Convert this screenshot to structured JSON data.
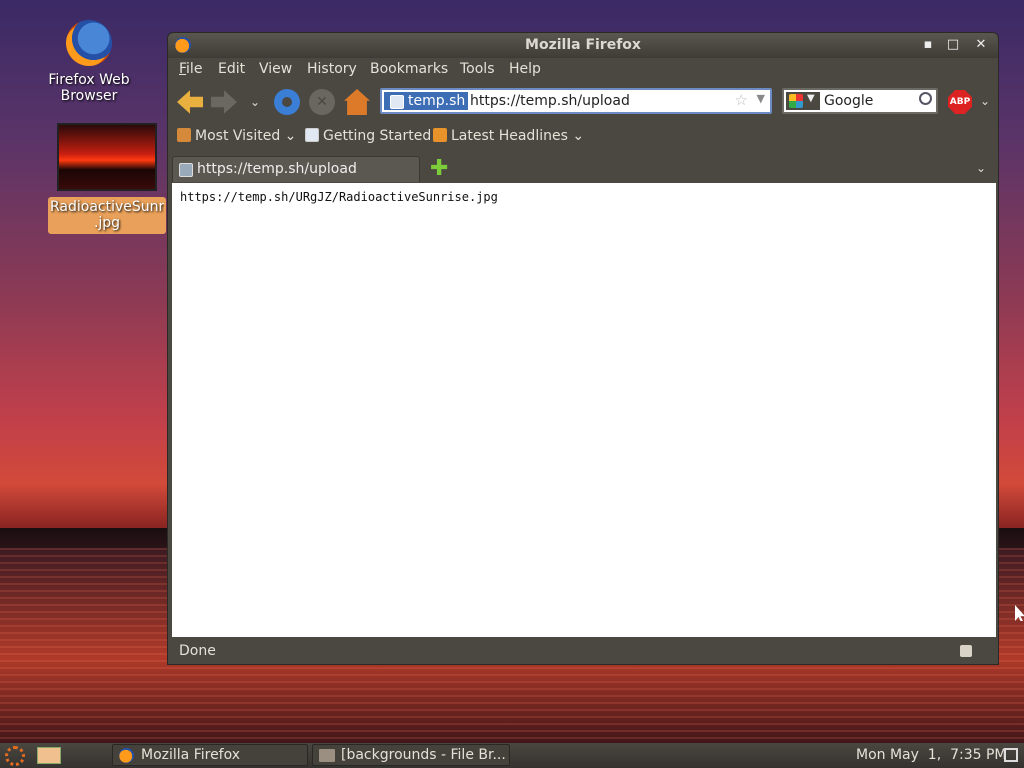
{
  "desktop": {
    "icons": [
      {
        "label": "Firefox Web Browser",
        "icon": "firefox-icon"
      },
      {
        "label_line1": "RadioactiveSunris",
        "label_line2": ".jpg",
        "icon": "image-thumbnail"
      }
    ]
  },
  "window": {
    "title": "Mozilla Firefox",
    "controls": {
      "minimize": "▪",
      "maximize": "□",
      "close": "✕"
    },
    "menu": [
      "File",
      "Edit",
      "View",
      "History",
      "Bookmarks",
      "Tools",
      "Help"
    ],
    "menu_mnemonics": [
      "F",
      "E",
      "V",
      "i",
      "B",
      "T",
      "H"
    ],
    "nav": {
      "site_badge": "temp.sh",
      "url": "https://temp.sh/upload",
      "search_engine": "Google",
      "adblock_label": "ABP"
    },
    "bookmarks": [
      {
        "label": "Most Visited",
        "dropdown": true
      },
      {
        "label": "Getting Started",
        "dropdown": false
      },
      {
        "label": "Latest Headlines",
        "dropdown": true
      }
    ],
    "tabs": [
      {
        "label": "https://temp.sh/upload",
        "active": true
      }
    ],
    "content_text": "https://temp.sh/URgJZ/RadioactiveSunrise.jpg",
    "status": "Done"
  },
  "panel": {
    "tasks": [
      {
        "label": "Mozilla Firefox",
        "icon": "firefox-icon"
      },
      {
        "label": "[backgrounds - File Br...",
        "icon": "file-browser-icon"
      }
    ],
    "clock": "Mon May  1,  7:35 PM"
  },
  "colors": {
    "window_bg": "#4b4842",
    "url_highlight": "#3d6db5",
    "file_label_bg": "#e8a05a"
  }
}
